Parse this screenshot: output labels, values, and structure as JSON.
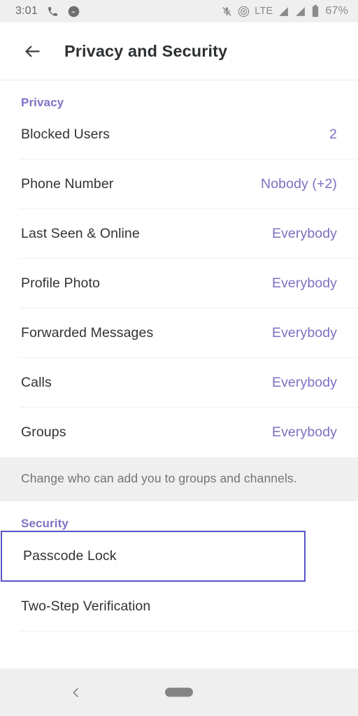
{
  "status_bar": {
    "time": "3:01",
    "left_icons": [
      "phone-icon",
      "messenger-icon"
    ],
    "network_label": "LTE",
    "battery_percent": "67%",
    "right_icons": [
      "microphone-muted-icon",
      "hotspot-icon",
      "signal-bar-icon",
      "signal-bar-icon",
      "battery-icon"
    ]
  },
  "appbar": {
    "back_icon": "arrow-back-icon",
    "title": "Privacy and Security"
  },
  "sections": [
    {
      "header": "Privacy",
      "rows": [
        {
          "label": "Blocked Users",
          "value": "2"
        },
        {
          "label": "Phone Number",
          "value": "Nobody (+2)"
        },
        {
          "label": "Last Seen & Online",
          "value": "Everybody"
        },
        {
          "label": "Profile Photo",
          "value": "Everybody"
        },
        {
          "label": "Forwarded Messages",
          "value": "Everybody"
        },
        {
          "label": "Calls",
          "value": "Everybody"
        },
        {
          "label": "Groups",
          "value": "Everybody"
        }
      ],
      "footer": "Change who can add you to groups and channels."
    },
    {
      "header": "Security",
      "rows": [
        {
          "label": "Passcode Lock",
          "value": ""
        },
        {
          "label": "Two-Step Verification",
          "value": ""
        }
      ],
      "footer": ""
    }
  ],
  "navbar": {
    "back_icon": "chevron-left-icon",
    "home_indicator": "home-pill-indicator"
  },
  "colors": {
    "accent_purple": "#7d70c2",
    "section_header_purple": "#7f72c6",
    "focus_border": "#5a53c9",
    "text_primary": "#303234",
    "text_secondary": "#717477",
    "chrome_gray": "#efefef"
  }
}
